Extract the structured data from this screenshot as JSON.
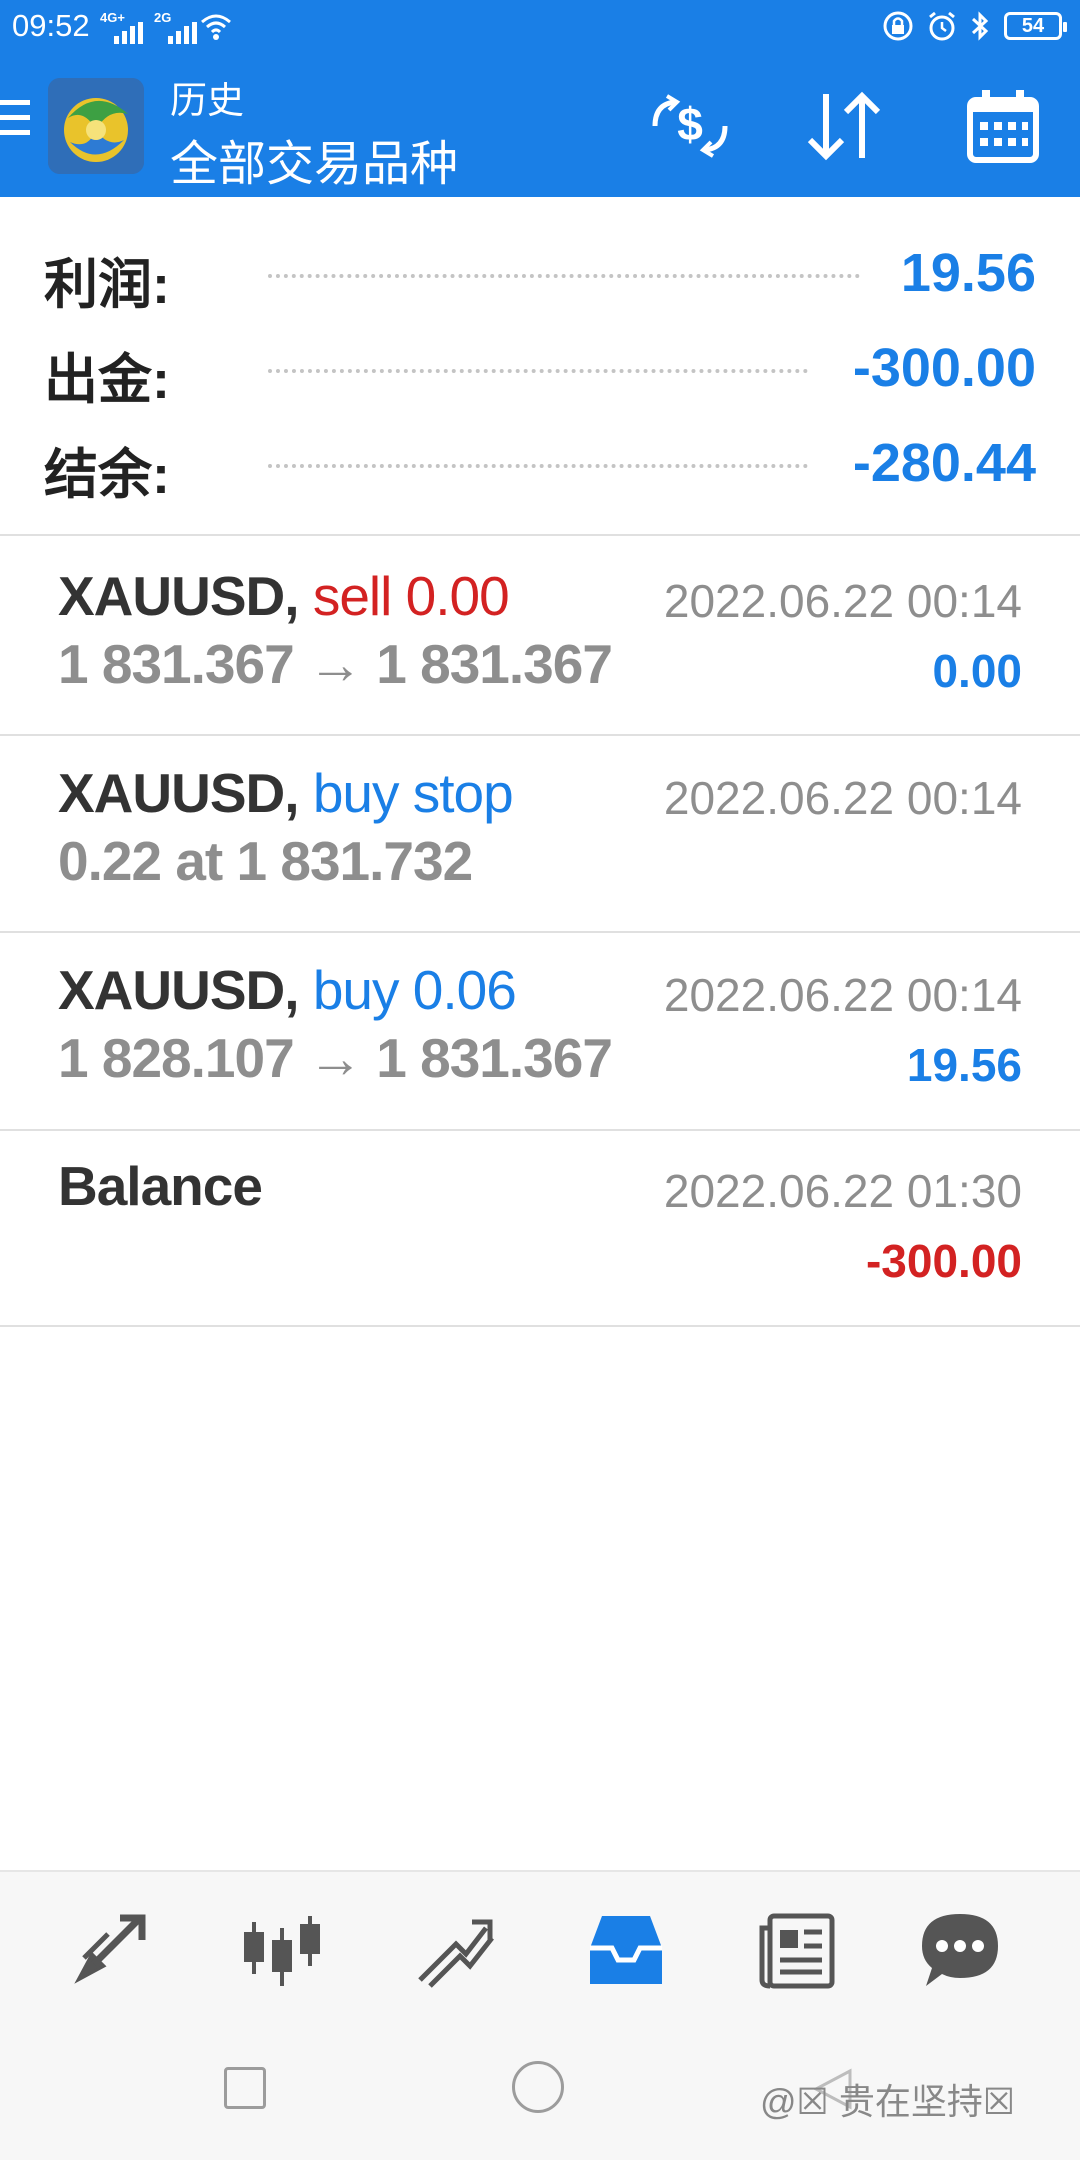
{
  "status_bar": {
    "time": "09:52",
    "signal1_label": "4G+",
    "signal2_label": "2G",
    "battery": "54"
  },
  "app_bar": {
    "title": "历史",
    "subtitle": "全部交易品种"
  },
  "summary": [
    {
      "label": "利润:",
      "value": "19.56"
    },
    {
      "label": "出金:",
      "value": "-300.00"
    },
    {
      "label": "结余:",
      "value": "-280.44"
    }
  ],
  "trades": [
    {
      "symbol": "XAUUSD,",
      "action": "sell 0.00",
      "line2": "1 831.367 → 1 831.367",
      "time": "2022.06.22 00:14",
      "amount": "0.00"
    },
    {
      "symbol": "XAUUSD,",
      "action": "buy stop",
      "line2": "0.22 at 1 831.732",
      "time": "2022.06.22 00:14",
      "amount": ""
    },
    {
      "symbol": "XAUUSD,",
      "action": "buy 0.06",
      "line2": "1 828.107 → 1 831.367",
      "time": "2022.06.22 00:14",
      "amount": "19.56"
    },
    {
      "symbol": "Balance",
      "action": "",
      "line2": "",
      "time": "2022.06.22 01:30",
      "amount": "-300.00"
    }
  ],
  "bottom_nav": [
    "quotes-icon",
    "chart-icon",
    "trade-icon",
    "history-icon",
    "news-icon",
    "chat-icon"
  ],
  "watermark": "@☒ 贵在坚持☒",
  "colors": {
    "primary": "#1a7fe6",
    "negative": "#d32222",
    "text_dark": "#333333",
    "text_gray": "#8e8e8e"
  }
}
